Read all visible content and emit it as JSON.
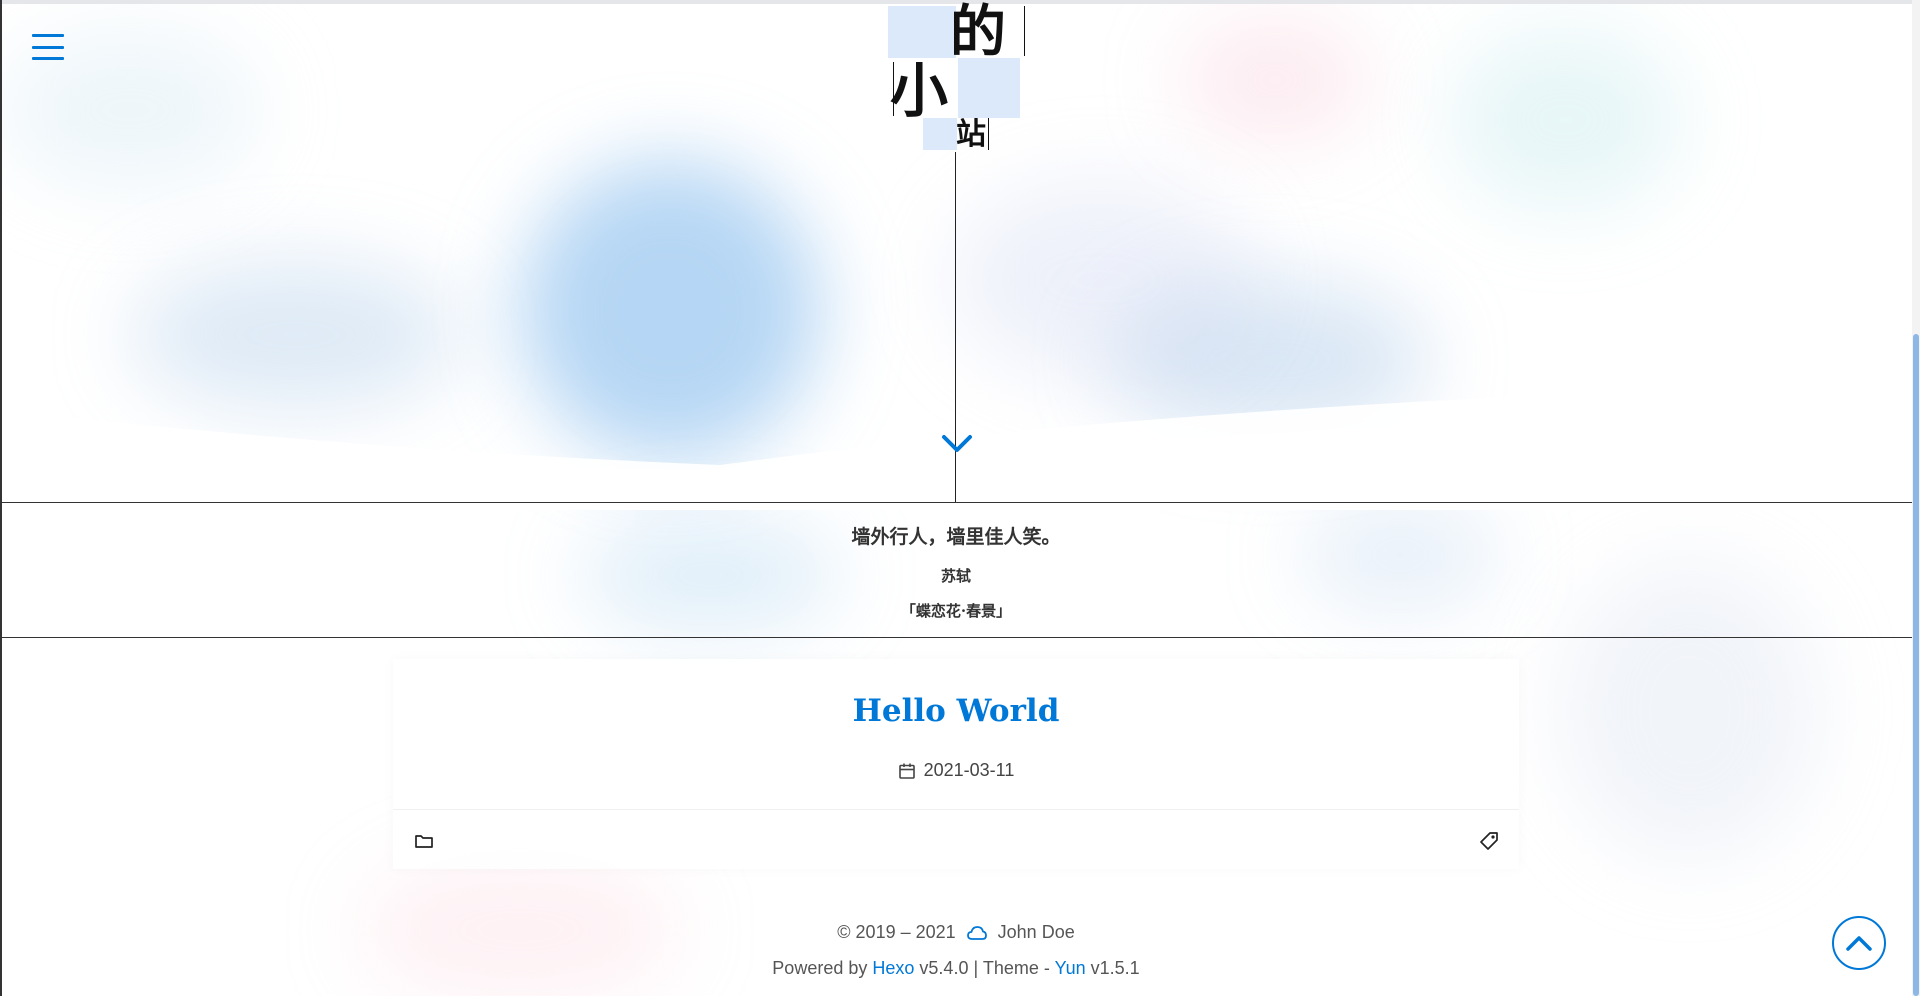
{
  "site": {
    "title_chars": [
      "的",
      "小",
      "站"
    ]
  },
  "header": {
    "menu_icon": "hamburger-icon",
    "scroll_down_icon": "chevron-down-icon"
  },
  "quote": {
    "text": "墙外行人，墙里佳人笑。",
    "author": "苏轼",
    "source": "「蝶恋花·春景」"
  },
  "post": {
    "title": "Hello World",
    "date": "2021-03-11",
    "date_icon": "calendar-icon",
    "category_icon": "folder-icon",
    "tag_icon": "tag-icon"
  },
  "footer": {
    "copyright": "© 2019 – 2021",
    "author_icon": "cloud-icon",
    "author": "John Doe",
    "powered_by": "Powered by",
    "hexo_link": "Hexo",
    "hexo_version": "v5.4.0",
    "separator": "|",
    "theme_label": "Theme -",
    "theme_link": "Yun",
    "theme_version": "v1.5.1"
  },
  "back_to_top_icon": "chevron-up-icon",
  "colors": {
    "accent": "#0078d7",
    "text": "#333333",
    "title_tint": "#dbe9fa",
    "scrollbar": "#8cb7e6"
  }
}
